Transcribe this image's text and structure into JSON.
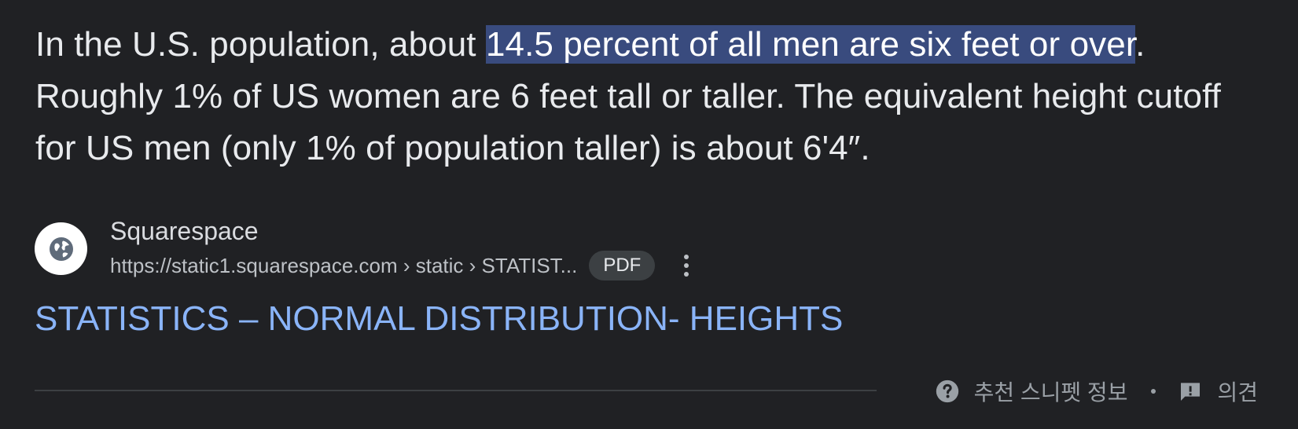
{
  "snippet": {
    "text_before": "In the U.S. population, about ",
    "highlight": "14.5 percent of all men are six feet or over",
    "text_after": ". Roughly 1% of US women are 6 feet tall or taller. The equivalent height cutoff for US men (only 1% of population taller) is about 6'4″."
  },
  "source": {
    "site_name": "Squarespace",
    "url": "https://static1.squarespace.com › static › STATIST...",
    "badge": "PDF",
    "favicon": "globe-icon",
    "menu_icon": "more-vert-icon"
  },
  "result": {
    "title": "STATISTICS – NORMAL DISTRIBUTION- HEIGHTS"
  },
  "footer": {
    "about_label": "추천 스니펫 정보",
    "about_icon": "help-circle-icon",
    "feedback_label": "의견",
    "feedback_icon": "feedback-icon"
  },
  "colors": {
    "background": "#202124",
    "text": "#e8eaed",
    "highlight": "#394b7e",
    "link": "#8ab4f8",
    "muted": "#9aa0a6"
  }
}
